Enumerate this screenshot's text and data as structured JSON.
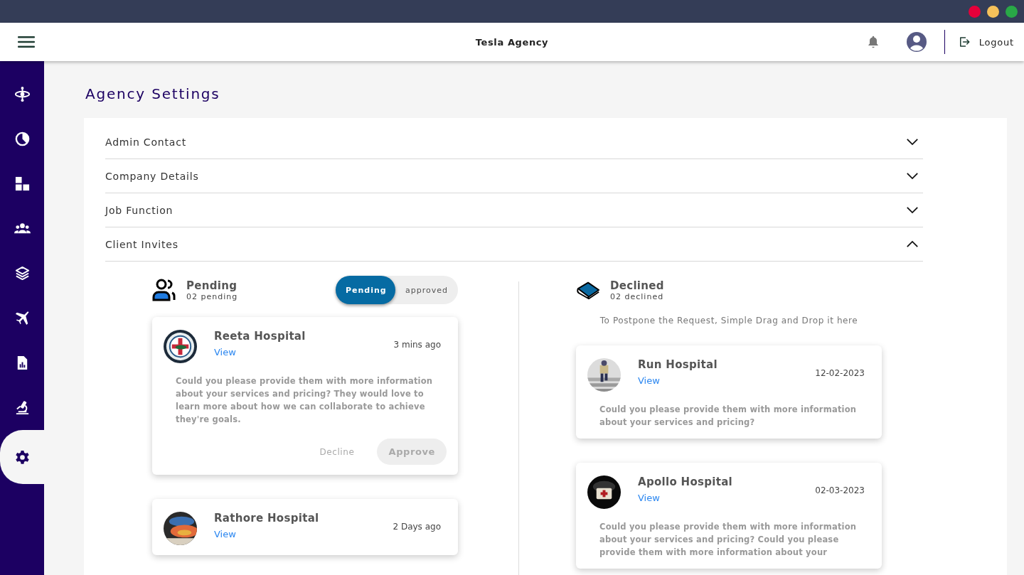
{
  "header": {
    "title": "Tesla Agency",
    "logout": "Logout"
  },
  "sidebar": {
    "items": [
      {
        "kind": "orbit",
        "selected": false
      },
      {
        "kind": "pie",
        "selected": false
      },
      {
        "kind": "blocks",
        "selected": false
      },
      {
        "kind": "team",
        "selected": false
      },
      {
        "kind": "layers",
        "selected": false
      },
      {
        "kind": "plane",
        "selected": false
      },
      {
        "kind": "report",
        "selected": false
      },
      {
        "kind": "microscope",
        "selected": false
      },
      {
        "kind": "gear",
        "selected": true
      }
    ]
  },
  "page_title": "Agency Settings",
  "sections": [
    {
      "title": "Admin Contact",
      "expanded": false
    },
    {
      "title": "Company Details",
      "expanded": false
    },
    {
      "title": "Job Function",
      "expanded": false
    },
    {
      "title": "Client Invites",
      "expanded": true
    }
  ],
  "pending": {
    "title": "Pending",
    "count": "02 pending",
    "toggle": [
      {
        "label": "Pending",
        "selected": true
      },
      {
        "label": "approved",
        "selected": false
      }
    ],
    "cards": [
      {
        "name": "Reeta Hospital",
        "link": "View",
        "time": "3 mins ago",
        "message": "Could you please provide them with more information about your services and pricing? They would love to learn more about how we can collaborate to achieve they're  goals.",
        "actions": [
          "Decline",
          "Approve"
        ]
      },
      {
        "name": "Rathore Hospital",
        "link": "View",
        "time": "2 Days ago"
      }
    ]
  },
  "declined": {
    "title": "Declined",
    "count": "02 declined",
    "hint": "To Postpone the Request, Simple Drag and Drop it here",
    "cards": [
      {
        "name": "Run Hospital",
        "link": "View",
        "time": "12-02-2023",
        "message": "Could you please provide them with more information about your services and pricing?"
      },
      {
        "name": "Apollo Hospital",
        "link": "View",
        "time": "02-03-2023",
        "message": "Could you please provide them with more information about your services and pricing? Could you please provide them with more information about your"
      }
    ]
  }
}
